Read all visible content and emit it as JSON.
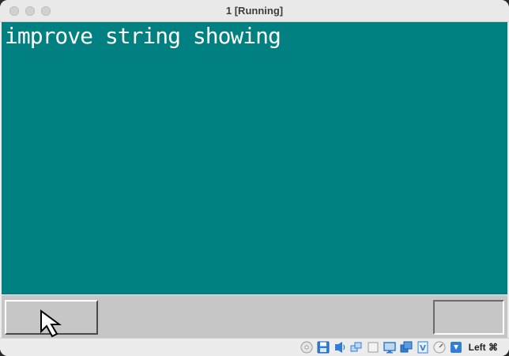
{
  "window": {
    "title": "1 [Running]"
  },
  "screen": {
    "text": "improve string showing",
    "background": "#008080",
    "text_color": "#ffffff"
  },
  "guest_taskbar": {
    "background": "#c6c6c6"
  },
  "statusbar": {
    "host_key_label": "Left ⌘",
    "icons": [
      "optical-drive-icon",
      "floppy-icon",
      "audio-icon",
      "network-icon",
      "usb-icon",
      "shared-folders-icon",
      "display-icon",
      "recording-icon",
      "cpu-icon",
      "mouse-integration-icon",
      "keyboard-capture-icon"
    ]
  }
}
